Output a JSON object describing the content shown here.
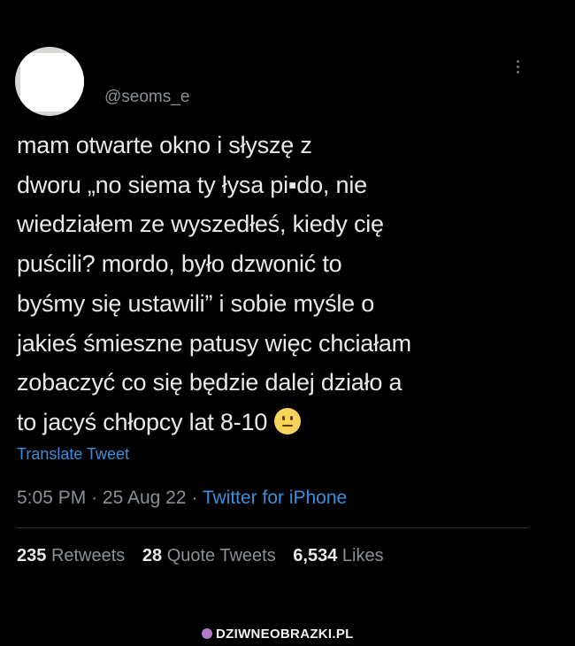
{
  "tweet": {
    "display_name": "",
    "handle": "@seoms_e",
    "text": "mam otwarte okno i słyszę z\ndworu „no siema ty łysa pi▪do, nie\nwiedziałem ze wyszedłeś, kiedy cię\npuścili? mordo, było dzwonić to\nbyśmy się ustawili” i sobie myśle o\njakieś śmieszne patusy więc chciałam\nzobaczyć co się będzie dalej działo a\nto jacyś chłopcy lat 8-10",
    "emoji_icon": "neutral-face-emoji",
    "translate_label": "Translate Tweet",
    "time": "5:05 PM",
    "date": "25 Aug 22",
    "separator": "·",
    "source": "Twitter for iPhone",
    "stats": {
      "retweets_count": "235",
      "retweets_label": "Retweets",
      "quotes_count": "28",
      "quotes_label": "Quote Tweets",
      "likes_count": "6,534",
      "likes_label": "Likes"
    }
  },
  "watermark": {
    "text": "DZIWNEOBRAZKI.PL"
  },
  "colors": {
    "background": "#000000",
    "text_primary": "#e7e9ea",
    "text_secondary": "#8b9096",
    "link": "#3b8fde"
  },
  "icons": {
    "more": "more-options-icon",
    "avatar": "avatar",
    "watermark": "watermark-logo-icon"
  }
}
